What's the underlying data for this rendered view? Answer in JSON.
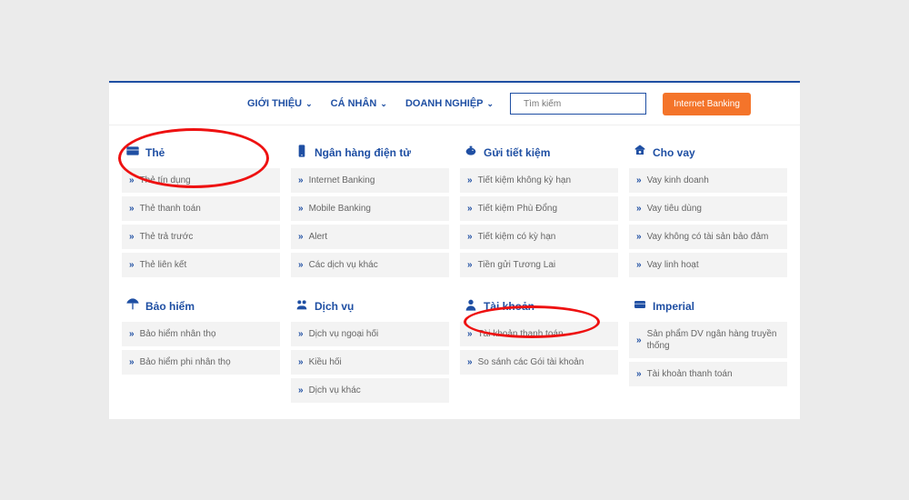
{
  "nav": {
    "items": [
      "GIỚI THIỆU",
      "CÁ NHÂN",
      "DOANH NGHIỆP"
    ],
    "search_placeholder": "Tìm kiếm",
    "ibank_label": "Internet Banking"
  },
  "sections": [
    {
      "title": "Thẻ",
      "icon": "card",
      "items": [
        "Thẻ tín dụng",
        "Thẻ thanh toán",
        "Thẻ trả trước",
        "Thẻ liên kết"
      ]
    },
    {
      "title": "Ngân hàng điện tử",
      "icon": "mobile",
      "items": [
        "Internet Banking",
        "Mobile Banking",
        "Alert",
        "Các dịch vụ khác"
      ]
    },
    {
      "title": "Gửi tiết kiệm",
      "icon": "piggy",
      "items": [
        "Tiết kiệm không kỳ hạn",
        "Tiết kiệm Phù Đổng",
        "Tiết kiệm có kỳ hạn",
        "Tiền gửi Tương Lai"
      ]
    },
    {
      "title": "Cho vay",
      "icon": "loan",
      "items": [
        "Vay kinh doanh",
        "Vay tiêu dùng",
        "Vay không có tài sản bảo đảm",
        "Vay linh hoạt"
      ]
    },
    {
      "title": "Bảo hiểm",
      "icon": "umbrella",
      "items": [
        "Bảo hiểm nhân thọ",
        "Bảo hiểm phi nhân thọ"
      ]
    },
    {
      "title": "Dịch vụ",
      "icon": "service",
      "items": [
        "Dịch vụ ngoại hối",
        "Kiều hối",
        "Dịch vụ khác"
      ]
    },
    {
      "title": "Tài khoản",
      "icon": "account",
      "items": [
        "Tài khoản thanh toán",
        "So sánh các Gói tài khoản"
      ]
    },
    {
      "title": "Imperial",
      "icon": "imperial",
      "items": [
        "Sản phẩm DV ngân hàng truyền thống",
        "Tài khoản thanh toán"
      ]
    }
  ]
}
